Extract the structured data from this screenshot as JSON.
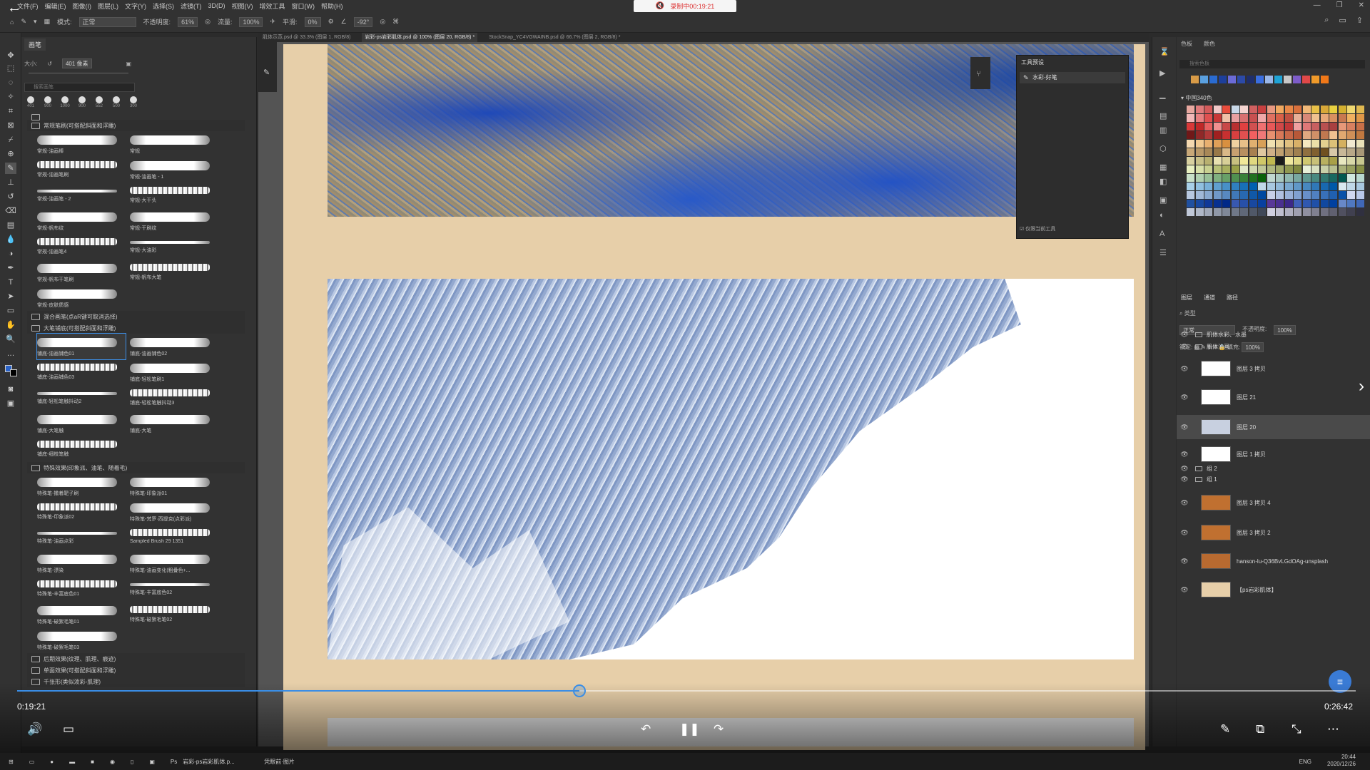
{
  "menubar": {
    "items": [
      "文件(F)",
      "编辑(E)",
      "图像(I)",
      "图层(L)",
      "文字(Y)",
      "选择(S)",
      "滤镜(T)",
      "3D(D)",
      "视图(V)",
      "增效工具",
      "窗口(W)",
      "帮助(H)"
    ]
  },
  "recording": {
    "label": "录制中00:19:21"
  },
  "options_bar": {
    "mode_label": "模式:",
    "mode_value": "正常",
    "opacity_label": "不透明度:",
    "opacity_value": "61%",
    "flow_label": "流量:",
    "flow_value": "100%",
    "smooth_label": "平滑:",
    "smooth_value": "0%",
    "angle_value": "-92°"
  },
  "doc_tabs": [
    {
      "label": "肌体示范.psd @ 33.3% (图层 1, RGB/8)",
      "active": false
    },
    {
      "label": "岩彩-ps岩彩肌体.psd @ 100% (图层 20, RGB/8) *",
      "active": true
    },
    {
      "label": "StockSnap_YC4VGWAINB.psd @ 66.7% (图层 2, RGB/8) *",
      "active": false
    }
  ],
  "brush_panel": {
    "tab": "画笔",
    "size_label": "大小:",
    "size_value": "401 像素",
    "search_placeholder": "搜索画笔",
    "presets": [
      "401",
      "900",
      "1000",
      "900",
      "552",
      "500",
      "300"
    ],
    "group1": "常规笔刷(可搭配斜面和浮雕)",
    "group1_brushes": [
      "常规-油画棒",
      "常规",
      "常规-油画笔刷",
      "常规-油画笔 - 1",
      "常规-油画笔 - 2",
      "常规-大干头",
      "常规-帆布纹",
      "常规-干刷纹",
      "常规-油画笔4",
      "常规-大油彩",
      "常规-帆布干笔刷",
      "常规-帆布大笔",
      "常规-皮肤质感"
    ],
    "group2": "混合画笔(点aR键可取消选择)",
    "group3": "大笔铺底(可搭配斜面和浮雕)",
    "group3_brushes": [
      "铺底-油画铺色01",
      "铺底-油画铺色02",
      "铺底-油画铺色03",
      "铺底-轻松笔刷1",
      "铺底-轻松笔触抖动2",
      "铺底-轻松笔触抖动3",
      "铺底-大笔触",
      "铺底-大笔",
      "铺底-细枝笔触"
    ],
    "group4": "特殊效果(印象派、油笔、随着毛)",
    "group4_brushes": [
      "特殊笔-撒着靶子刷",
      "特殊笔-印象派01",
      "特殊笔-印象派02",
      "特殊笔-梵罗·西提克(点彩派)",
      "特殊笔-油画点彩",
      "Sampled Brush 29 1351",
      "特殊笔-漂染",
      "特殊笔-油画变化(粗叠色+...",
      "特殊笔-丰富底色01",
      "特殊笔-丰富底色02",
      "特殊笔-破絮毛笔01",
      "特殊笔-破絮毛笔02",
      "特殊笔-破絮毛笔03"
    ],
    "group5": "后期效果(纹理、肌理、痕迹)",
    "group6": "单面效果(可搭配斜面和浮雕)",
    "group7": "千张形(类似泼彩-肌理)"
  },
  "tool_presets": {
    "title": "工具预设",
    "item": "水彩-好笔",
    "footer": "仅限当前工具"
  },
  "swatches": {
    "tabs": [
      "色板",
      "颜色"
    ],
    "search_placeholder": "搜索色板",
    "group_name": "中国340色",
    "recent_colors": [
      "#d89b47",
      "#5aa0e0",
      "#2a6bd1",
      "#1d3f9c",
      "#6b6bd8",
      "#2c4aa8",
      "#1f2e6b",
      "#3a6ee0",
      "#9ab7e8",
      "#1fa3d6",
      "#c7c7c7",
      "#7d5cc8",
      "#e04848",
      "#f09a2a",
      "#f07818"
    ],
    "grid_colors": [
      "#e8a8a0",
      "#e07a7a",
      "#d45a5a",
      "#f0c8c8",
      "#e84c3c",
      "#c8d8e8",
      "#f4d4d0",
      "#d06060",
      "#c84040",
      "#e89880",
      "#f0a860",
      "#e88848",
      "#d8703c",
      "#f0b878",
      "#e8c048",
      "#d8a838",
      "#e8d040",
      "#d4b030",
      "#f0d870",
      "#e0b850",
      "#f2b8b8",
      "#e88080",
      "#e05050",
      "#c83838",
      "#f0c0a8",
      "#e8a0a0",
      "#d87070",
      "#c85050",
      "#f0a8a8",
      "#e07060",
      "#d86048",
      "#c05040",
      "#e8b098",
      "#d88878",
      "#f0c090",
      "#e8a878",
      "#d89060",
      "#c87850",
      "#f0b060",
      "#e09848",
      "#d83838",
      "#c02828",
      "#e86060",
      "#f09090",
      "#c84848",
      "#b83030",
      "#e04040",
      "#d05050",
      "#f07070",
      "#e85858",
      "#d04848",
      "#c03838",
      "#f0a0a0",
      "#e07878",
      "#c86060",
      "#b85050",
      "#a84040",
      "#e89878",
      "#d88060",
      "#c87048",
      "#701818",
      "#902828",
      "#b03838",
      "#a02020",
      "#c83030",
      "#d84040",
      "#e05050",
      "#f06060",
      "#f07878",
      "#e89070",
      "#d87858",
      "#c86848",
      "#b85838",
      "#e0a880",
      "#d09068",
      "#c07850",
      "#f0c090",
      "#e0a870",
      "#d09058",
      "#c07840",
      "#f4d8b0",
      "#f0c890",
      "#e8b070",
      "#e0a058",
      "#d89040",
      "#f0d0a0",
      "#e8c088",
      "#e0b070",
      "#d8a058",
      "#f0e0b0",
      "#e8d098",
      "#e0c080",
      "#d8b068",
      "#f4e8c0",
      "#ece0a8",
      "#e4d090",
      "#dcc078",
      "#d4b060",
      "#f0e8d0",
      "#e8e0b8",
      "#c8a878",
      "#b89868",
      "#a88858",
      "#987848",
      "#d8b888",
      "#c8a070",
      "#b89060",
      "#a88050",
      "#e0c8a0",
      "#d0b088",
      "#c0a070",
      "#b09060",
      "#a08050",
      "#907040",
      "#806030",
      "#705020",
      "#d8c8a8",
      "#c8b898",
      "#b8a888",
      "#a89878",
      "#d8d0a0",
      "#c8c088",
      "#b8b070",
      "#e8e0b0",
      "#d8d098",
      "#c8c080",
      "#f0e898",
      "#e0d880",
      "#d0c868",
      "#c0b850",
      "#1a1a1a",
      "#f0e8a0",
      "#e0d888",
      "#d0c870",
      "#c8c078",
      "#b8b060",
      "#a8a048",
      "#e8e8c0",
      "#d8d8a8",
      "#c8c890",
      "#e8f0c0",
      "#d8e0a8",
      "#c8d090",
      "#b8c078",
      "#a8b060",
      "#98a048",
      "#e0e8c8",
      "#d0d8b0",
      "#c0c898",
      "#b0b880",
      "#a0a868",
      "#909850",
      "#808840",
      "#e8f0d8",
      "#d8e0c0",
      "#c8d0a8",
      "#b8c090",
      "#a8b078",
      "#98a060",
      "#889048",
      "#c8e0c8",
      "#b0d0b0",
      "#98c098",
      "#80b080",
      "#68a068",
      "#509050",
      "#388038",
      "#207020",
      "#086008",
      "#c0d8d0",
      "#a8c8c0",
      "#90b8b0",
      "#78a8a0",
      "#609890",
      "#488880",
      "#307870",
      "#186860",
      "#005850",
      "#d0e8e0",
      "#b8d8d0",
      "#a8d0e8",
      "#90c0e0",
      "#78b0d8",
      "#60a0d0",
      "#4890c8",
      "#3080c0",
      "#1870b8",
      "#0060b0",
      "#c0d8e8",
      "#a8c8e0",
      "#90b8d8",
      "#78a8d0",
      "#6098c8",
      "#4888c0",
      "#3078b8",
      "#1868b0",
      "#0058a8",
      "#d8e8f0",
      "#c0d8e8",
      "#a8c8e0",
      "#b8c8e0",
      "#a0b8d8",
      "#88a8d0",
      "#7098c8",
      "#5888c0",
      "#4078b8",
      "#2868b0",
      "#1058a8",
      "#0048a0",
      "#c8d0e8",
      "#b0c0e0",
      "#98b0d8",
      "#80a0d0",
      "#6890c8",
      "#5080c0",
      "#3870b8",
      "#2060b0",
      "#0850a8",
      "#d0d8f0",
      "#b8c8e8",
      "#2050a0",
      "#1848a0",
      "#103898",
      "#083090",
      "#002888",
      "#3858b0",
      "#2850a8",
      "#1848a0",
      "#0840a0",
      "#583898",
      "#4a3090",
      "#3c2888",
      "#4060b8",
      "#3058b0",
      "#2050a8",
      "#1048a0",
      "#0040a0",
      "#6888c8",
      "#5078c0",
      "#4068b8",
      "#c0c8d8",
      "#b0b8c8",
      "#a0a8b8",
      "#9098a8",
      "#808898",
      "#707888",
      "#606878",
      "#505868",
      "#404858",
      "#d0d0e0",
      "#c0c0d0",
      "#b0b0c0",
      "#a0a0b0",
      "#9090a0",
      "#808090",
      "#707080",
      "#606070",
      "#505060",
      "#404050",
      "#303040"
    ]
  },
  "layers_panel": {
    "tabs": [
      "图层",
      "通道",
      "路径"
    ],
    "filter_label": "类型",
    "blend_mode": "正常",
    "opacity_label": "不透明度:",
    "opacity_value": "100%",
    "lock_label": "锁定:",
    "fill_label": "填充:",
    "fill_value": "100%",
    "layers": [
      {
        "name": "肌体水彩、水墨",
        "type": "group"
      },
      {
        "name": "肌体油画",
        "type": "group"
      },
      {
        "name": "图层 3 拷贝",
        "type": "layer",
        "thumb": "#ffffff"
      },
      {
        "name": "图层 21",
        "type": "layer",
        "thumb": "#ffffff"
      },
      {
        "name": "图层 20",
        "type": "layer",
        "thumb": "#c8d0e0",
        "selected": true
      },
      {
        "name": "图层 1 拷贝",
        "type": "layer",
        "thumb": "#ffffff"
      },
      {
        "name": "组 2",
        "type": "group"
      },
      {
        "name": "组 1",
        "type": "group"
      },
      {
        "name": "图层 3 拷贝 4",
        "type": "layer",
        "thumb": "#c07030"
      },
      {
        "name": "图层 3 拷贝 2",
        "type": "layer",
        "thumb": "#c07030"
      },
      {
        "name": "hanson-lu-Q36BvLGdOAg-unsplash",
        "type": "layer",
        "thumb": "#b86a30"
      },
      {
        "name": "【ps岩彩肌体】",
        "type": "layer",
        "thumb": "#e7cfa9"
      }
    ]
  },
  "player": {
    "current_time": "0:19:21",
    "duration": "0:26:42",
    "progress": 0.42
  },
  "taskbar": {
    "app1": "岩彩-ps岩彩肌体.p...",
    "app2": "凭眼前·图片",
    "time": "20:44",
    "date": "2020/12/26",
    "lang": "ENG"
  }
}
